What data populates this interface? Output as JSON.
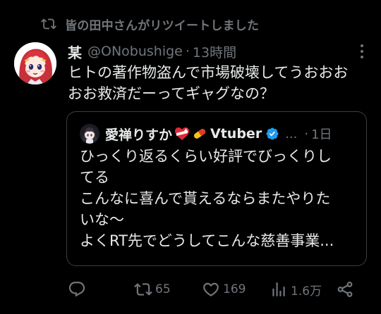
{
  "retweet": {
    "text": "皆の田中さんがリツイートしました",
    "icon": "retweet-icon"
  },
  "tweet": {
    "display_name": "某",
    "handle": "@ONobushige",
    "separator": "·",
    "time": "13時間",
    "body_lines": [
      "ヒトの著作物盗んで市場破壊してうおおお",
      "おお救済だーってギャグなの？"
    ]
  },
  "quote": {
    "display_name": "愛禅りすか",
    "display_name_suffix": "Vtuber",
    "emoji": [
      "heart-with-ribbon",
      "pill"
    ],
    "ellipsis": "...",
    "separator": "·",
    "time": "1日",
    "body_lines": [
      "ひっくり返るくらい好評でびっくりし",
      "てる",
      "こんなに喜んで貰えるならまたやりた",
      "いな～",
      "よくRT先でどうしてこんな慈善事業..."
    ]
  },
  "actions": {
    "reply_count": "",
    "retweet_count": "65",
    "like_count": "169",
    "views_count": "1.6万"
  },
  "colors": {
    "background": "#000000",
    "text": "#e7e9ea",
    "muted": "#71767b",
    "verified": "#1d9bf0",
    "border": "#3a3e42"
  }
}
